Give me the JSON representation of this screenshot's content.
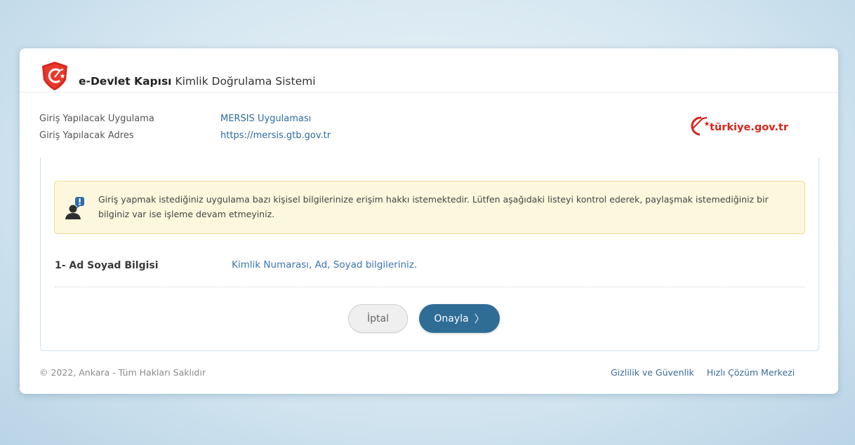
{
  "header": {
    "brand_bold": "e-Devlet Kapısı",
    "brand_sub": "Kimlik Doğrulama Sistemi"
  },
  "app_info": {
    "app_label": "Giriş Yapılacak Uygulama",
    "app_value": "MERSIS Uygulaması",
    "address_label": "Giriş Yapılacak Adres",
    "address_value": "https://mersis.gtb.gov.tr"
  },
  "logo": {
    "text": "türkiye.gov.tr"
  },
  "notice": {
    "text": "Giriş yapmak istediğiniz uygulama bazı kişisel bilgilerinize erişim hakkı istemektedir. Lütfen aşağıdaki listeyi kontrol ederek, paylaşmak istemediğiniz bir bilginiz var ise işleme devam etmeyiniz."
  },
  "permissions": [
    {
      "title": "1- Ad Soyad Bilgisi",
      "description": "Kimlik Numarası, Ad, Soyad bilgileriniz."
    }
  ],
  "buttons": {
    "cancel": "İptal",
    "confirm": "Onayla",
    "confirm_chevron": "〉"
  },
  "footer": {
    "copyright": "© 2022, Ankara - Tüm Hakları Saklıdır",
    "links": [
      "Gizlilik ve Güvenlik",
      "Hızlı Çözüm Merkezi"
    ]
  },
  "colors": {
    "accent": "#2f6d97",
    "link": "#2d6aa0",
    "brand_red": "#d7261b",
    "notice_bg": "#fcf7dd",
    "notice_border": "#eedb94"
  },
  "icons": {
    "brand": "edevlet-shield-icon",
    "notice": "user-alert-icon",
    "logo": "turkiye-gov-logo"
  }
}
